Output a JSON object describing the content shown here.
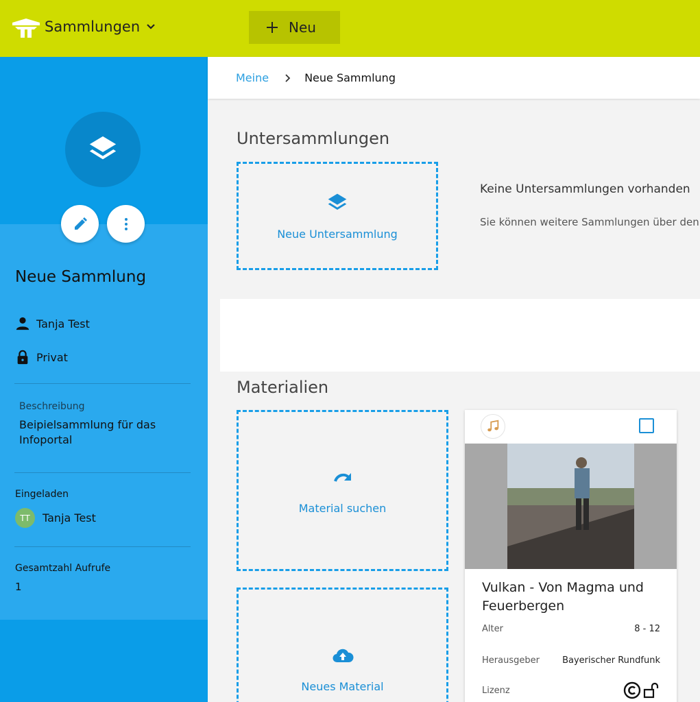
{
  "topbar": {
    "collections_label": "Sammlungen",
    "new_label": "Neu",
    "accent_color": "#cfdc00"
  },
  "breadcrumb": {
    "root": "Meine",
    "current": "Neue Sammlung"
  },
  "sidebar": {
    "collection_name": "Neue Sammlung",
    "owner": "Tanja Test",
    "visibility": "Privat",
    "description_label": "Beschreibung",
    "description": "Beipielsammlung für das Infoportal",
    "invited_label": "Eingeladen",
    "invited_initials": "TT",
    "invited_name": "Tanja Test",
    "views_label": "Gesamtzahl Aufrufe",
    "views_value": "1",
    "color": "#0a9de8"
  },
  "subcollections": {
    "title": "Untersammlungen",
    "new_label": "Neue Untersammlung",
    "empty_title": "Keine Untersammlungen vorhanden",
    "empty_text": "Sie können weitere Sammlungen über den"
  },
  "materials": {
    "title": "Materialien",
    "search_label": "Material suchen",
    "new_label": "Neues Material",
    "card": {
      "type_icon": "music-note-icon",
      "title": "Vulkan - Von Magma und Feuerbergen",
      "age_label": "Alter",
      "age_value": "8 - 12",
      "publisher_label": "Herausgeber",
      "publisher_value": "Bayerischer Rundfunk",
      "license_label": "Lizenz"
    }
  }
}
